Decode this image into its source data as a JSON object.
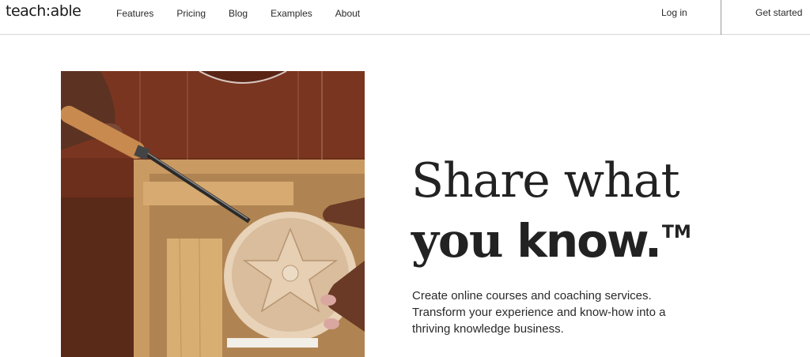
{
  "nav": {
    "logo": "teach:able",
    "links": [
      "Features",
      "Pricing",
      "Blog",
      "Examples",
      "About"
    ],
    "login": "Log in",
    "get_started": "Get started"
  },
  "hero": {
    "headline_line1": "Share what",
    "headline_line2_serif": "you",
    "headline_line2_sans": "know.",
    "trademark": "TM",
    "subtext_lines": [
      "Create online courses and coaching services.",
      "Transform your experience and know-how into a",
      "thriving knowledge business."
    ],
    "image_subject": "wood-carving-photo"
  },
  "colors": {
    "text": "#222222",
    "background": "#ffffff",
    "divider": "#d8d8d8"
  }
}
